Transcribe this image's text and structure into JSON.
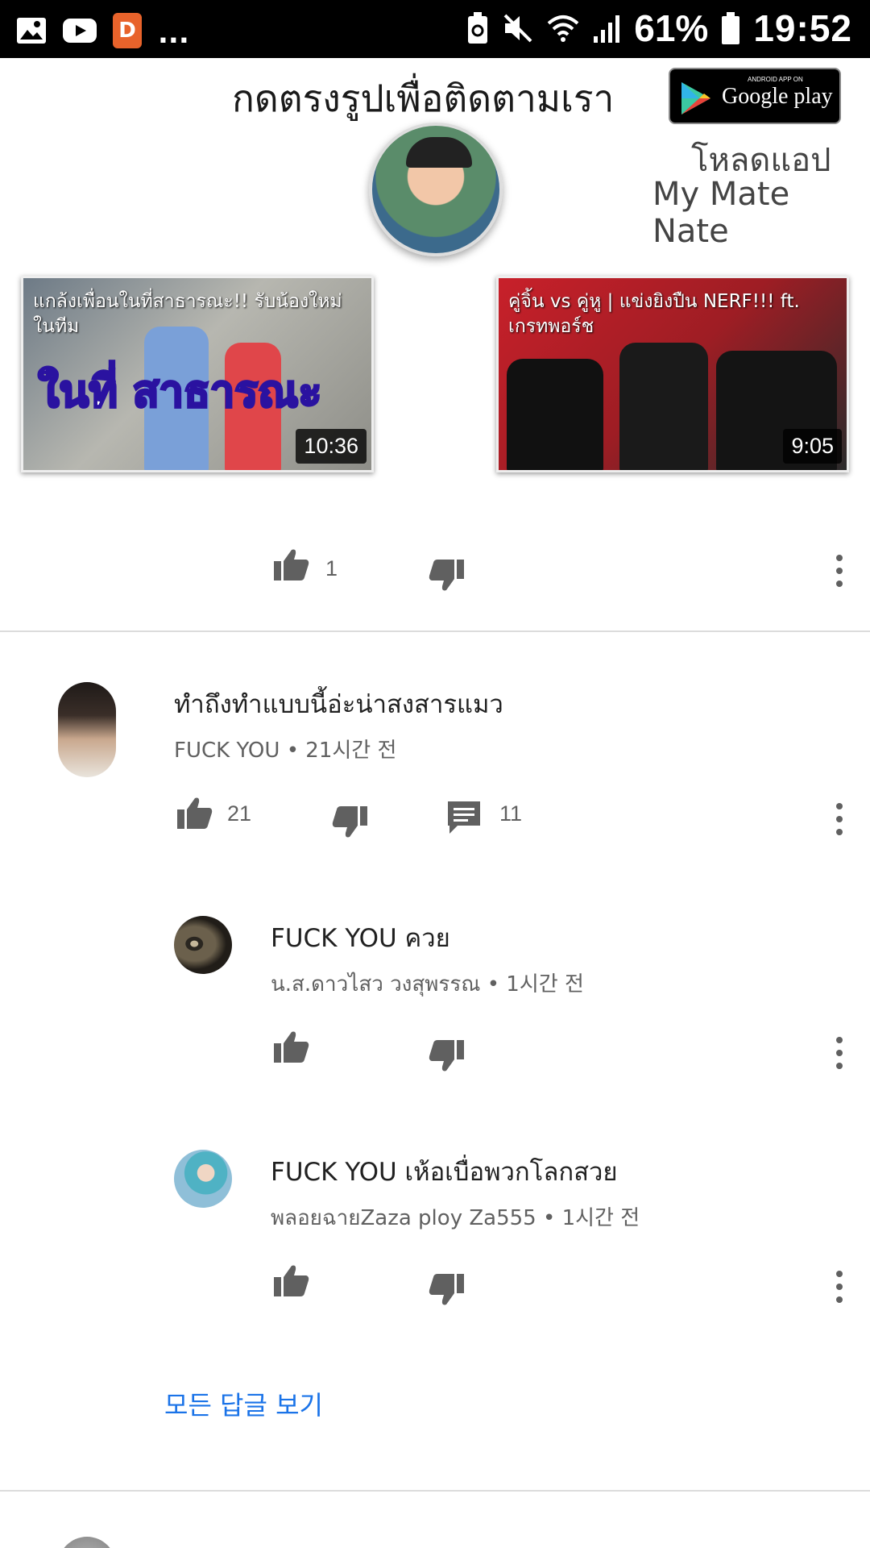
{
  "status_bar": {
    "battery": "61%",
    "time": "19:52",
    "more": "...",
    "icons": [
      "gallery-icon",
      "youtube-icon",
      "app-badge-icon",
      "battery-saver-icon",
      "mute-icon",
      "wifi-icon",
      "signal-icon",
      "battery-icon"
    ]
  },
  "banner": {
    "title": "กดตรงรูปเพื่อติดตามเรา",
    "gplay_small": "ANDROID APP ON",
    "gplay_big": "Google play",
    "download_label": "โหลดแอป",
    "app_name": "My Mate Nate",
    "thumbnails": [
      {
        "title": "แกล้งเพื่อนในที่สาธารณะ!! รับน้องใหม่ในทีม",
        "overlay": "ในที่ สาธารณะ",
        "duration": "10:36"
      },
      {
        "title": "คู่จิ้น vs คู่หู | แข่งยิงปืน NERF!!! ft. เกรทพอร์ช",
        "duration": "9:05"
      }
    ]
  },
  "top_actions": {
    "like_count": "1"
  },
  "comments": [
    {
      "text": "ทำถึงทำแบบนี้อ่ะน่าสงสารแมว",
      "author": "FUCK YOU",
      "time": "21시간 전",
      "like_count": "21",
      "reply_count": "11"
    }
  ],
  "replies": [
    {
      "text": "FUCK YOU ควย",
      "author": "น.ส.ดาวไสว วงสุพรรณ",
      "time": "1시간 전"
    },
    {
      "text": "FUCK YOU เห้อเบื่อพวกโลกสวย",
      "author": "พลอยฉายZaza ploy Za555",
      "time": "1시간 전"
    }
  ],
  "see_all_replies": "모든 답글 보기",
  "colors": {
    "link": "#1a73e8",
    "icon": "#606060",
    "divider": "#dcdcdc"
  }
}
